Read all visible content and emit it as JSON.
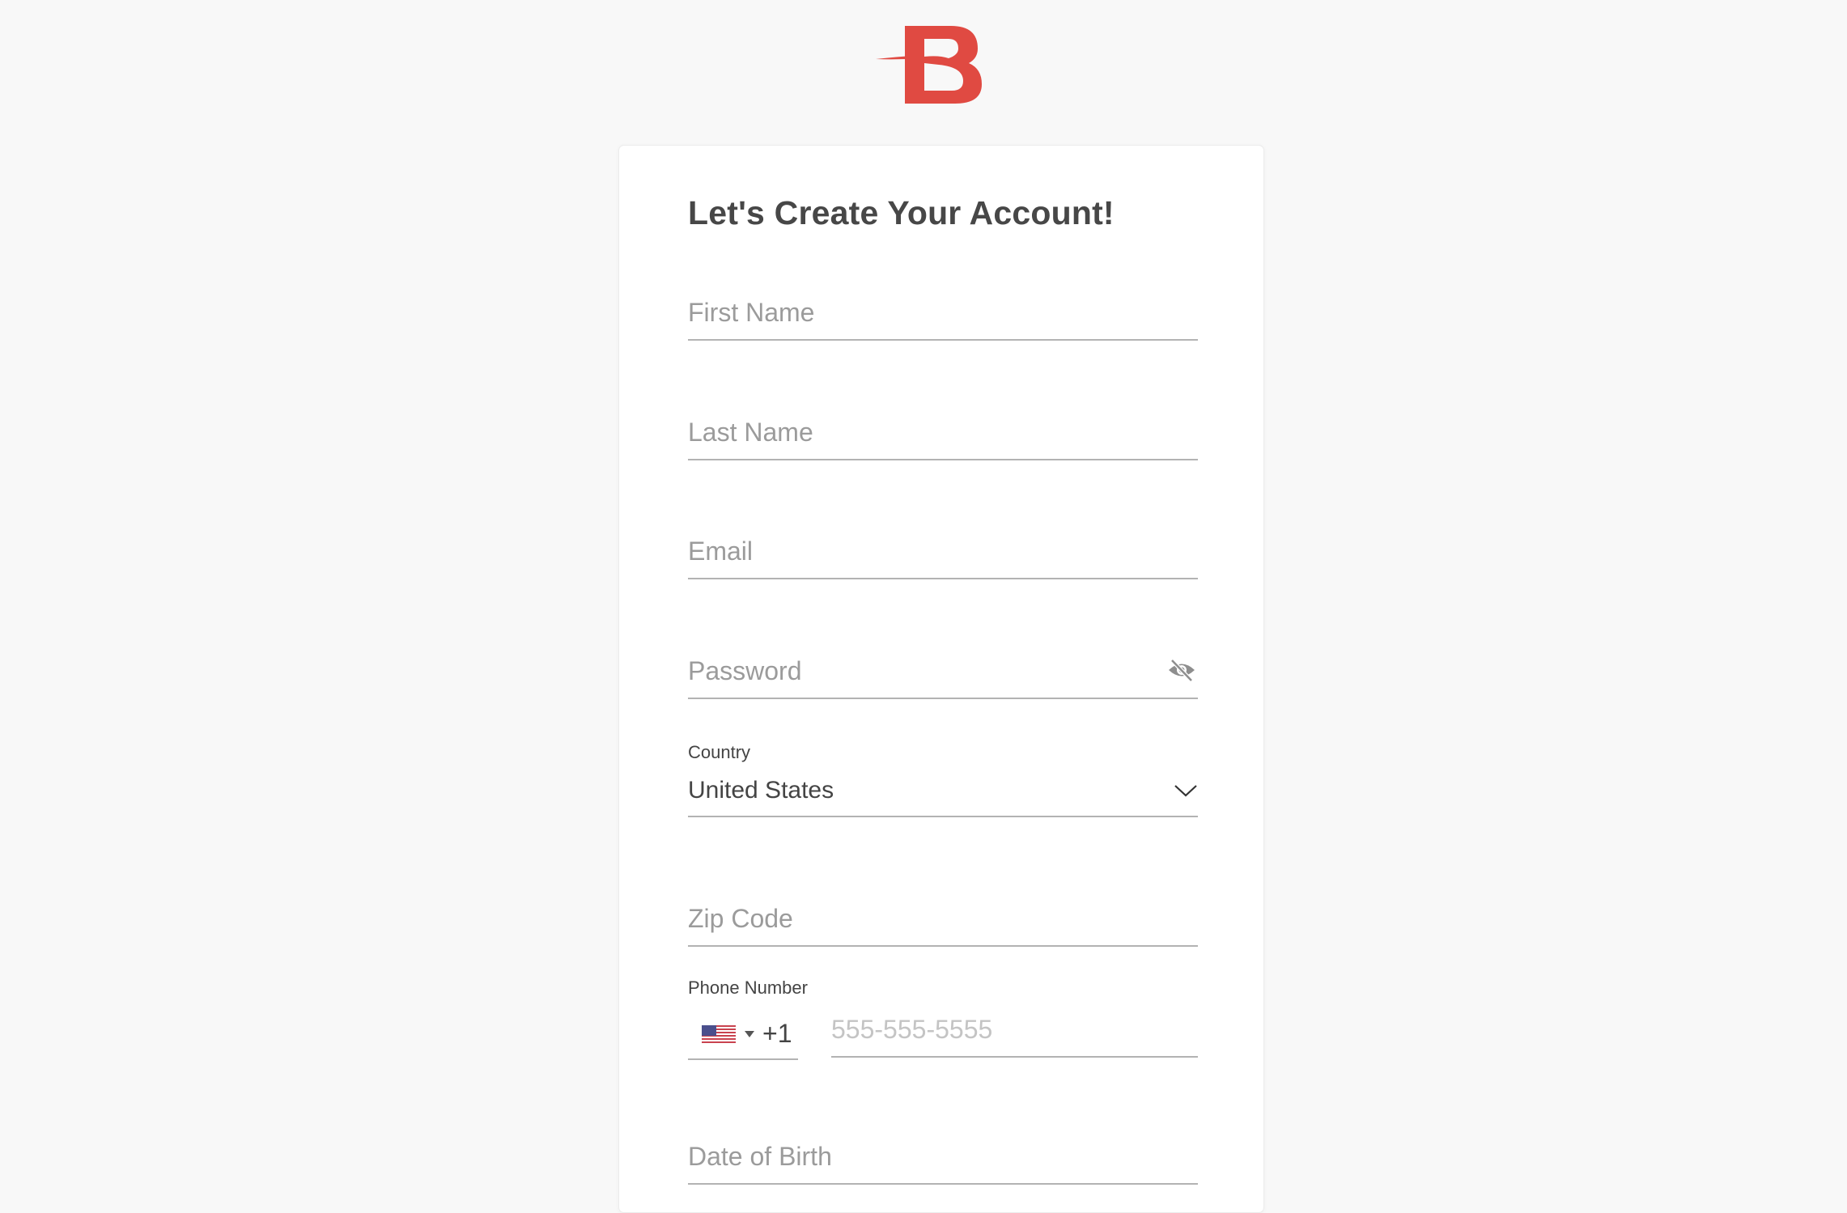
{
  "brand": {
    "logo_letter": "B",
    "logo_icon": "brand-b-logo",
    "accent": "#e04a42"
  },
  "form": {
    "title": "Let's Create Your Account!",
    "first_name": {
      "placeholder": "First Name",
      "value": ""
    },
    "last_name": {
      "placeholder": "Last Name",
      "value": ""
    },
    "email": {
      "placeholder": "Email",
      "value": ""
    },
    "password": {
      "placeholder": "Password",
      "value": "",
      "toggle_icon": "eye-off-icon"
    },
    "country": {
      "label": "Country",
      "value": "United States",
      "icon": "chevron-down-icon"
    },
    "zip": {
      "placeholder": "Zip Code",
      "value": ""
    },
    "phone": {
      "label": "Phone Number",
      "country_flag": "us-flag-icon",
      "dial_code": "+1",
      "placeholder": "555-555-5555",
      "value": ""
    },
    "dob": {
      "placeholder": "Date of Birth",
      "value": ""
    }
  }
}
